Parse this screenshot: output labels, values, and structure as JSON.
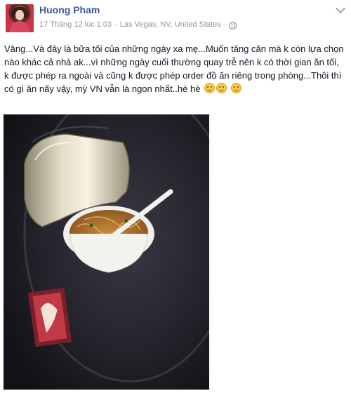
{
  "post": {
    "author": "Huong Pham",
    "date": "17 Tháng 12 lúc 1:03",
    "location": "Las Vegas, NV, United States",
    "separator": "·",
    "privacy_icon": "globe-icon",
    "menu_icon": "chevron-down-icon",
    "text": "Vâng...Và đây là bữa tối của những ngày xa mẹ...Muốn tăng cân mà k còn lựa chọn nào khác cả nhà ak...vì những ngày cuối thường quay trễ nên k có thời gian ăn tối, k được phép ra ngoài và cũng k được phép order đồ ăn riêng trong phòng...Thôi thì có gì ăn nấy vậy, mỳ VN vẫn là ngon nhất..hè hè",
    "emojis": [
      "smile-emoji",
      "smile-emoji",
      "smile-emoji"
    ],
    "photo_description_icon": "instant-noodle-cup-photo"
  },
  "colors": {
    "author": "#3b5998",
    "meta": "#90949c",
    "text": "#141823",
    "background": "#ffffff"
  }
}
